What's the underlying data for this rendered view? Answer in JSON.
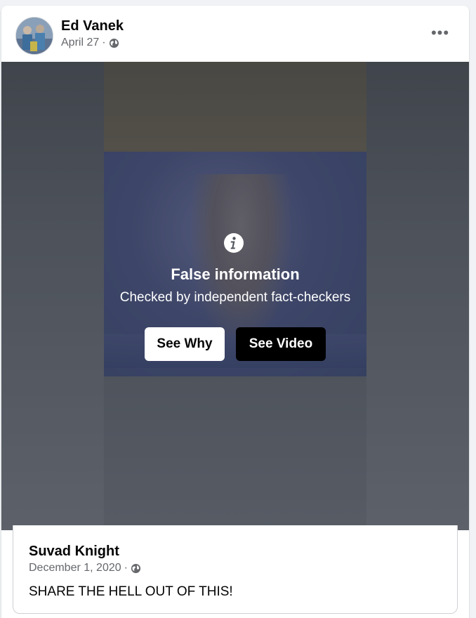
{
  "post": {
    "author_name": "Ed Vanek",
    "date": "April 27",
    "separator": "·",
    "privacy_icon": "globe-icon",
    "more_icon": "more-horizontal-icon",
    "more_label": "•••"
  },
  "fact_check": {
    "icon": "info-icon",
    "title": "False information",
    "subtitle": "Checked by independent fact-checkers",
    "see_why_label": "See Why",
    "see_video_label": "See Video"
  },
  "shared_post": {
    "author_name": "Suvad Knight",
    "date": "December 1, 2020",
    "separator": "·",
    "privacy_icon": "globe-icon",
    "text": "SHARE THE HELL OUT OF THIS!"
  },
  "colors": {
    "page_bg": "#f0f2f5",
    "card_bg": "#ffffff",
    "secondary_text": "#65676b",
    "primary_text": "#050505",
    "see_video_bg": "#000000"
  }
}
